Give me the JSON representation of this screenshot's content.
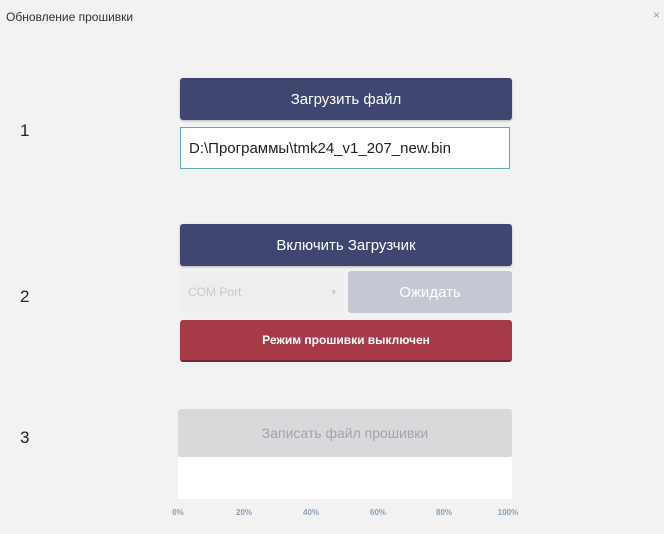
{
  "window": {
    "title": "Обновление прошивки",
    "close_label": "×"
  },
  "steps": {
    "one": "1",
    "two": "2",
    "three": "3"
  },
  "load_file": {
    "button_label": "Загрузить файл",
    "file_path": "D:\\Программы\\tmk24_v1_207_new.bin"
  },
  "bootloader": {
    "button_label": "Включить Загрузчик",
    "port_placeholder": "COM Port",
    "wait_label": "Ожидать",
    "status_text": "Режим прошивки выключен"
  },
  "write": {
    "button_label": "Записать файл прошивки",
    "progress": 0,
    "ticks": [
      "0%",
      "20%",
      "40%",
      "60%",
      "80%",
      "100%"
    ]
  },
  "colors": {
    "primary_button": "#3f4770",
    "status_off": "#a63a47",
    "disabled_button": "#d9d9dc",
    "input_border": "#5fa9b9"
  },
  "icons": {
    "close": "close-icon",
    "dropdown": "chevron-down-icon"
  }
}
